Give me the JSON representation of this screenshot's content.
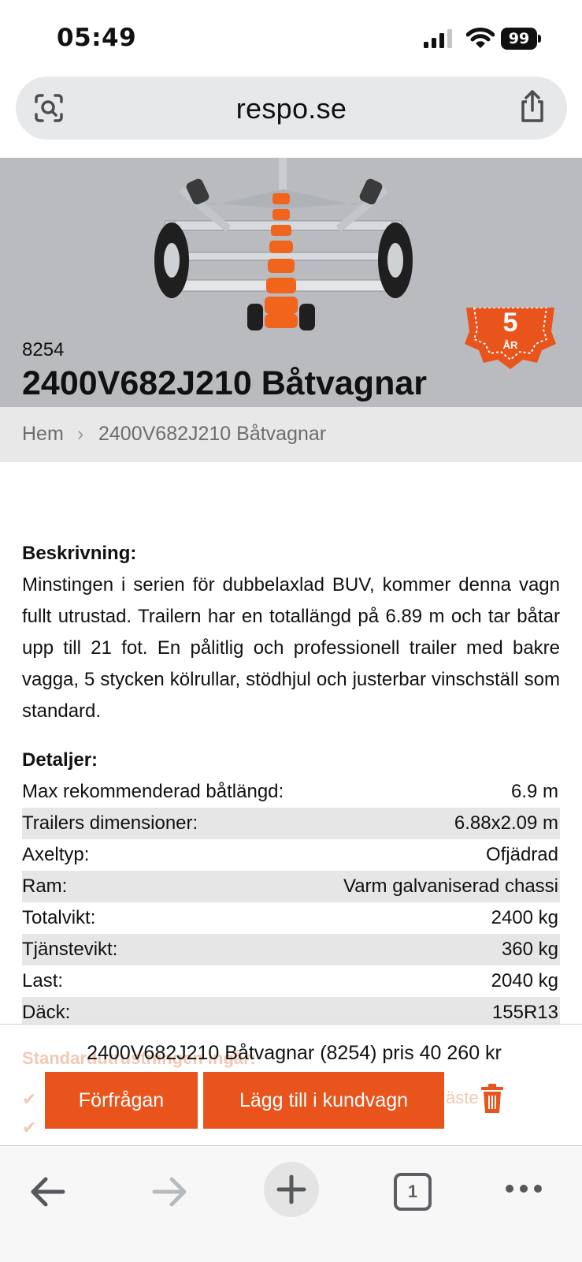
{
  "status_bar": {
    "time": "05:49",
    "battery": "99",
    "icons": [
      "cellular-signal-icon",
      "wifi-icon",
      "battery-icon"
    ]
  },
  "url_bar": {
    "domain": "respo.se",
    "left_icon": "page-scan-icon",
    "right_icon": "share-icon"
  },
  "hero": {
    "badge_number": "5",
    "badge_text": "ÅR",
    "sku": "8254",
    "title": "2400V682J210 Båtvagnar"
  },
  "breadcrumb": {
    "home": "Hem",
    "separator": "›",
    "current": "2400V682J210 Båtvagnar"
  },
  "description": {
    "heading": "Beskrivning:",
    "text": "Minstingen i serien för dubbelaxlad BUV, kommer denna vagn fullt utrustad. Trailern har en totallängd på 6.89 m och tar båtar upp till 21 fot. En pålitlig och professionell trailer med bakre vagga, 5 stycken kölrullar, stödhjul och justerbar vinschställ som standard."
  },
  "details": {
    "heading": "Detaljer:",
    "rows": [
      {
        "label": "Max rekommenderad båtlängd:",
        "value": "6.9 m"
      },
      {
        "label": "Trailers dimensioner:",
        "value": "6.88x2.09 m"
      },
      {
        "label": "Axeltyp:",
        "value": "Ofjädrad"
      },
      {
        "label": "Ram:",
        "value": "Varm galvaniserad chassi"
      },
      {
        "label": "Totalvikt:",
        "value": "2400 kg"
      },
      {
        "label": "Tjänstevikt:",
        "value": "360 kg"
      },
      {
        "label": "Last:",
        "value": "2040 kg"
      },
      {
        "label": "Däck:",
        "value": "155R13"
      }
    ]
  },
  "buy_panel": {
    "price_line": "2400V682J210 Båtvagnar (8254) pris 40 260 kr",
    "inquiry_label": "Förfrågan",
    "cart_label": "Lägg till i kundvagn",
    "under_heading": "Standardutrustningen ingår:",
    "under_fragment": "äste"
  },
  "toolbar": {
    "tab_count": "1"
  },
  "colors": {
    "accent": "#e8541c",
    "hero_bg": "#b9bbbe",
    "breadcrumb_bg": "#e8e8e8"
  }
}
